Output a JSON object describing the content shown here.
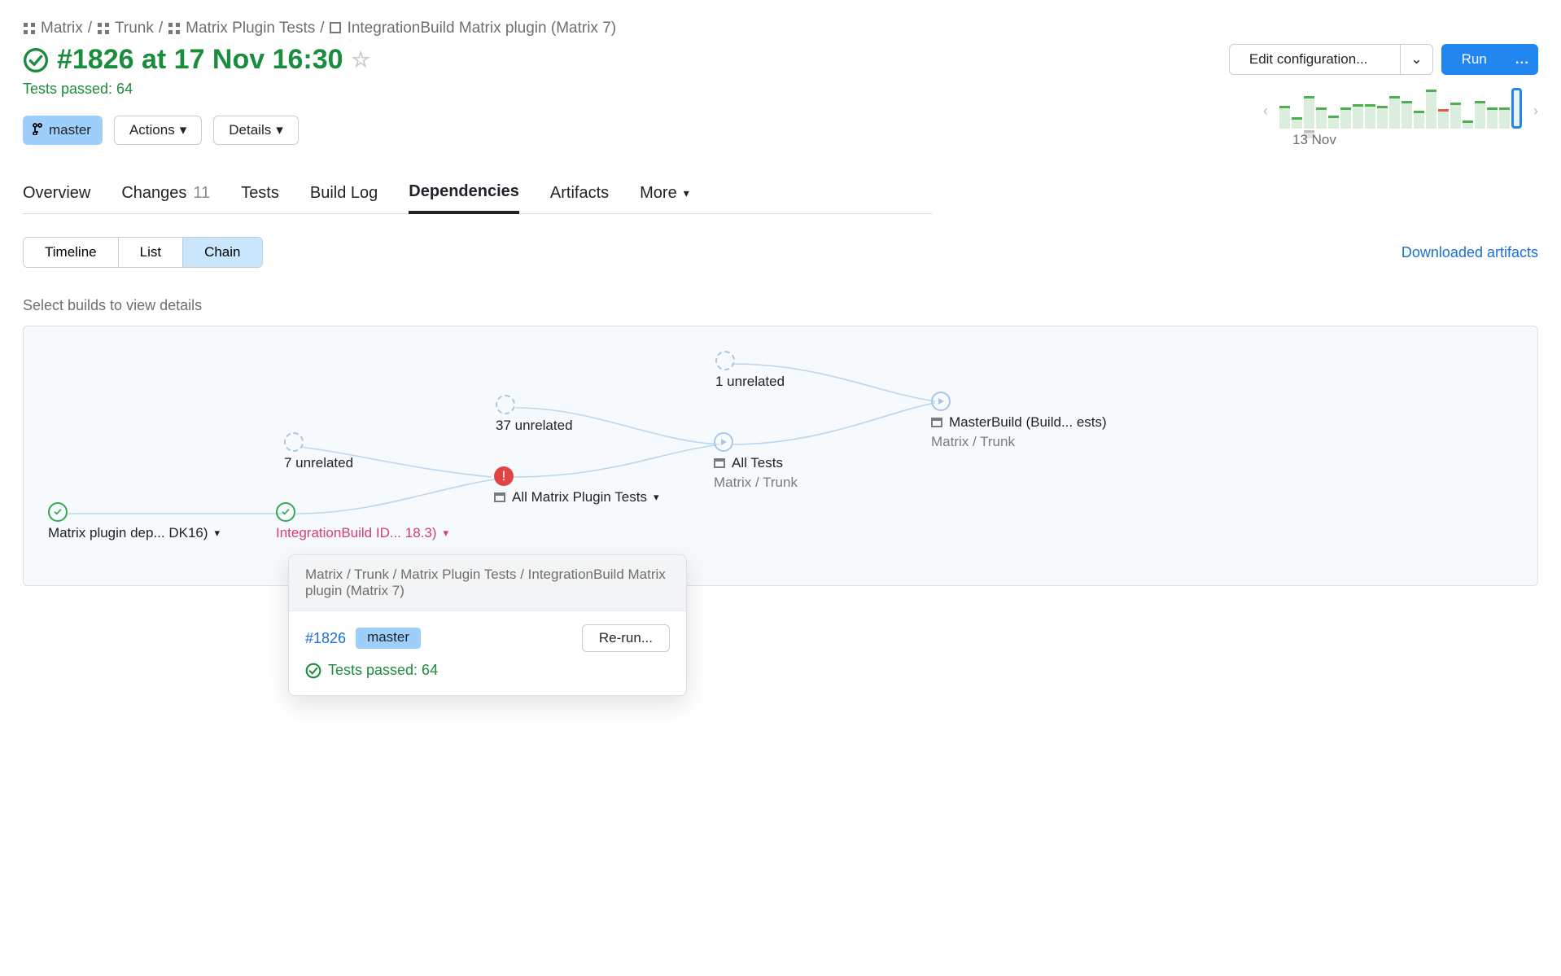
{
  "breadcrumb": {
    "items": [
      "Matrix",
      "Trunk",
      "Matrix Plugin Tests",
      "IntegrationBuild Matrix plugin (Matrix 7)"
    ]
  },
  "header": {
    "title": "#1826 at 17 Nov 16:30",
    "tests_passed": "Tests passed: 64"
  },
  "toolbar": {
    "edit_config": "Edit configuration...",
    "run": "Run",
    "more": "..."
  },
  "histogram": {
    "date_label": "13 Nov"
  },
  "branch": {
    "label": "master"
  },
  "actions_btn": "Actions",
  "details_btn": "Details",
  "tabs": {
    "items": [
      {
        "label": "Overview"
      },
      {
        "label": "Changes",
        "count": "11"
      },
      {
        "label": "Tests"
      },
      {
        "label": "Build Log"
      },
      {
        "label": "Dependencies",
        "active": true
      },
      {
        "label": "Artifacts"
      },
      {
        "label": "More"
      }
    ]
  },
  "seg": {
    "items": [
      "Timeline",
      "List",
      "Chain"
    ],
    "active": "Chain"
  },
  "downloaded_artifacts": "Downloaded artifacts",
  "hint": "Select builds to view details",
  "graph": {
    "n1": {
      "label": "Matrix plugin dep... DK16)"
    },
    "n2": {
      "label": "IntegrationBuild ID... 18.3)"
    },
    "n2group": {
      "label": "7 unrelated"
    },
    "n3group": {
      "label": "37 unrelated"
    },
    "n3": {
      "label": "All Matrix Plugin Tests"
    },
    "n4group": {
      "label": "1 unrelated"
    },
    "n4": {
      "label": "All Tests",
      "sub": "Matrix / Trunk"
    },
    "n5": {
      "label": "MasterBuild (Build... ests)",
      "sub": "Matrix / Trunk"
    }
  },
  "popover": {
    "path": "Matrix / Trunk / Matrix Plugin Tests / IntegrationBuild Matrix plugin (Matrix 7)",
    "build": "#1826",
    "branch": "master",
    "rerun": "Re-run...",
    "status": "Tests passed: 64"
  }
}
